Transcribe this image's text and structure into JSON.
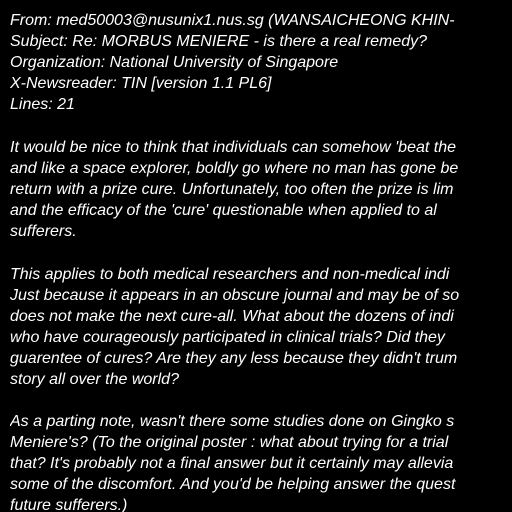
{
  "header": {
    "from": "From: med50003@nusunix1.nus.sg (WANSAICHEONG KHIN-",
    "subject": "Subject: Re: MORBUS MENIERE - is there a real remedy?",
    "organization": "Organization: National University of Singapore",
    "newsreader": "X-Newsreader: TIN [version 1.1 PL6]",
    "lines": "Lines: 21"
  },
  "body": {
    "paragraphs": [
      {
        "lines": [
          "It would be nice to think that individuals can somehow 'beat the",
          "and like a space explorer, boldly go where no man has gone be",
          "return with a prize cure. Unfortunately, too often the prize is lim",
          "and the efficacy of the 'cure' questionable when applied to al",
          "sufferers."
        ]
      },
      {
        "lines": [
          "This applies to both medical researchers and non-medical indi",
          "Just because it appears in an obscure journal and may be of so",
          "does not make the next cure-all. What about the dozens of indi",
          "who have courageously participated in clinical trials? Did they",
          "guarentee of cures? Are they any less because they didn't trum",
          "story all over the world?"
        ]
      },
      {
        "lines": [
          "As a parting note, wasn't there some studies done on Gingko s",
          "Meniere's? (To the original poster : what about trying for a trial",
          "that? It's probably not a final answer but it certainly may allevia",
          "some of the discomfort. And you'd be helping answer the quest",
          "future sufferers.)"
        ]
      }
    ]
  },
  "colors": {
    "background": "#000000",
    "text": "#ffffff"
  }
}
